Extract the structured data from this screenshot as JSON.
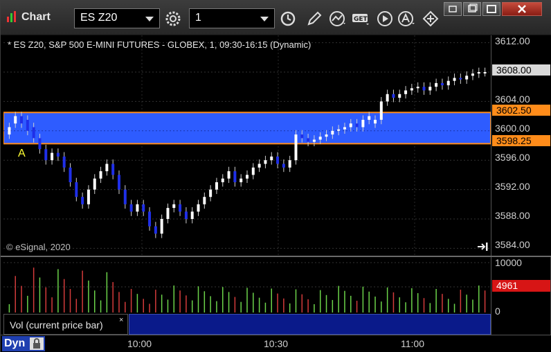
{
  "app": {
    "title": "Chart"
  },
  "toolbar": {
    "symbol": "ES Z20",
    "interval": "1",
    "colors": {
      "accent_text": "#ffffff",
      "bg": "#2d2d2d"
    }
  },
  "chart": {
    "title": "* ES Z20, S&P 500 E-MINI FUTURES - GLOBEX, 1, 09:30-16:15 (Dynamic)",
    "copyright": "© eSignal, 2020",
    "annotation": "A",
    "price_ticks": [
      "3612.00",
      "3604.00",
      "3600.00",
      "3596.00",
      "3592.00",
      "3588.00",
      "3584.00"
    ],
    "last_price_tag": "3608.00",
    "zone_top_tag": "3602.50",
    "zone_bottom_tag": "3598.25",
    "colors": {
      "bull": "#ffffff",
      "bear": "#1f2fe8",
      "zone_fill": "#2e5cff",
      "zone_border": "#ff8c1a"
    }
  },
  "volume": {
    "ticks": [
      "10000",
      "0"
    ],
    "last_tag": "4961",
    "study_label": "Vol (current price bar)",
    "close_glyph": "×",
    "colors": {
      "up": "#6cd44a",
      "down": "#d43b3b"
    }
  },
  "time_axis": {
    "mode": "Dyn",
    "ticks": [
      "10:00",
      "10:30",
      "11:00"
    ]
  },
  "chart_data": {
    "type": "candlestick",
    "ylim": [
      3583,
      3613
    ],
    "zone": [
      3598.25,
      3602.5
    ],
    "bars_open_close": [
      [
        3599.5,
        3600.5
      ],
      [
        3601,
        3602
      ],
      [
        3602,
        3601
      ],
      [
        3601.5,
        3600
      ],
      [
        3600.5,
        3599
      ],
      [
        3599,
        3597.5
      ],
      [
        3597.5,
        3596
      ],
      [
        3596,
        3597
      ],
      [
        3597,
        3596.5
      ],
      [
        3596.5,
        3595
      ],
      [
        3595,
        3593
      ],
      [
        3593,
        3591
      ],
      [
        3591,
        3590
      ],
      [
        3590,
        3592
      ],
      [
        3592,
        3593.5
      ],
      [
        3593.5,
        3594.5
      ],
      [
        3594.5,
        3595.5
      ],
      [
        3595.5,
        3594
      ],
      [
        3594,
        3592
      ],
      [
        3592,
        3590
      ],
      [
        3590,
        3589
      ],
      [
        3589,
        3590
      ],
      [
        3590,
        3589
      ],
      [
        3589,
        3587
      ],
      [
        3587,
        3586
      ],
      [
        3586,
        3588
      ],
      [
        3588,
        3589.5
      ],
      [
        3589.5,
        3590
      ],
      [
        3590,
        3589
      ],
      [
        3589,
        3588
      ],
      [
        3588,
        3589
      ],
      [
        3589,
        3590
      ],
      [
        3590,
        3591
      ],
      [
        3591,
        3592
      ],
      [
        3592,
        3593
      ],
      [
        3593,
        3593.5
      ],
      [
        3593.5,
        3594.5
      ],
      [
        3594.5,
        3593
      ],
      [
        3593,
        3593.5
      ],
      [
        3593.5,
        3594
      ],
      [
        3594,
        3595
      ],
      [
        3595,
        3595.5
      ],
      [
        3595.5,
        3596
      ],
      [
        3596,
        3596.5
      ],
      [
        3596.5,
        3595.5
      ],
      [
        3595.5,
        3595
      ],
      [
        3595,
        3596
      ],
      [
        3596,
        3599.5
      ],
      [
        3599.5,
        3599
      ],
      [
        3599,
        3598.5
      ],
      [
        3598.5,
        3598.8
      ],
      [
        3598.8,
        3599.2
      ],
      [
        3599.2,
        3599.5
      ],
      [
        3599.5,
        3600
      ],
      [
        3600,
        3600.2
      ],
      [
        3600.2,
        3600.5
      ],
      [
        3600.5,
        3601
      ],
      [
        3601,
        3600.5
      ],
      [
        3600.5,
        3601.5
      ],
      [
        3601.5,
        3602
      ],
      [
        3601,
        3601.5
      ],
      [
        3601.5,
        3604
      ],
      [
        3604,
        3605
      ],
      [
        3605,
        3604.5
      ],
      [
        3604.5,
        3605
      ],
      [
        3605,
        3605.5
      ],
      [
        3605.5,
        3605.8
      ],
      [
        3605.8,
        3606
      ],
      [
        3606,
        3605.5
      ],
      [
        3605.5,
        3606
      ],
      [
        3606,
        3606.5
      ],
      [
        3606.5,
        3606.2
      ],
      [
        3606.2,
        3606.8
      ],
      [
        3606.8,
        3607.2
      ],
      [
        3607.2,
        3607
      ],
      [
        3607,
        3607.5
      ],
      [
        3607.5,
        3607.8
      ],
      [
        3607.8,
        3608
      ],
      [
        3608,
        3608
      ]
    ],
    "volume_up_down": [
      1,
      0,
      0,
      1,
      0,
      1,
      0,
      0,
      1,
      0,
      0,
      0,
      0,
      1,
      1,
      1,
      1,
      0,
      0,
      0,
      0,
      1,
      0,
      0,
      0,
      1,
      1,
      1,
      0,
      0,
      1,
      1,
      1,
      1,
      1,
      1,
      1,
      0,
      1,
      1,
      1,
      1,
      1,
      1,
      0,
      0,
      1,
      1,
      0,
      0,
      1,
      1,
      1,
      1,
      1,
      1,
      1,
      0,
      1,
      1,
      1,
      1,
      1,
      0,
      1,
      1,
      1,
      1,
      0,
      1,
      1,
      0,
      1,
      1,
      0,
      1,
      1,
      1,
      0
    ]
  }
}
